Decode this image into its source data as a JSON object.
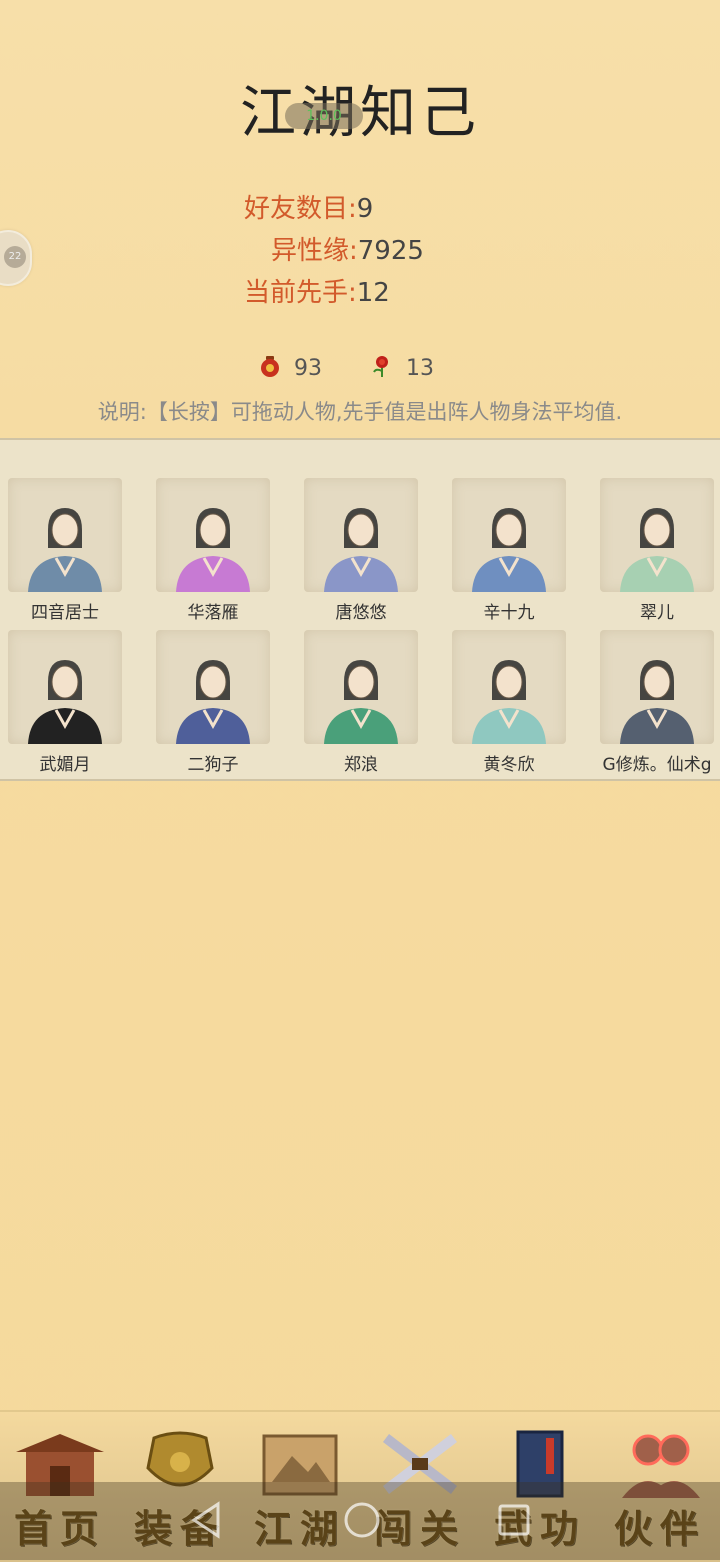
{
  "header": {
    "title": "江湖知己",
    "pill_text": "1.0.0"
  },
  "side_tab": {
    "badge": "22"
  },
  "stats": [
    {
      "label": "好友数目:",
      "value": "9"
    },
    {
      "label": "异性缘:",
      "value": "7925"
    },
    {
      "label": "当前先手:",
      "value": "12"
    }
  ],
  "resources": [
    {
      "icon": "wine-jar-icon",
      "value": "93"
    },
    {
      "icon": "rose-icon",
      "value": "13"
    }
  ],
  "description": "说明:【长按】可拖动人物,先手值是出阵人物身法平均值.",
  "characters": [
    {
      "name": "四音居士",
      "robe": "#6f8ca8"
    },
    {
      "name": "华落雁",
      "robe": "#c77ad3"
    },
    {
      "name": "唐悠悠",
      "robe": "#8a96c8"
    },
    {
      "name": "辛十九",
      "robe": "#6f8fc0"
    },
    {
      "name": "翠儿",
      "robe": "#a7d0b2"
    },
    {
      "name": "武媚月",
      "robe": "#222222"
    },
    {
      "name": "二狗子",
      "robe": "#4f5f9a"
    },
    {
      "name": "郑浪",
      "robe": "#4aa07a"
    },
    {
      "name": "黄冬欣",
      "robe": "#8fc8c0"
    },
    {
      "name": "G修炼。仙术g",
      "robe": "#556070"
    }
  ],
  "nav": [
    {
      "label": "首页",
      "icon": "house-icon"
    },
    {
      "label": "装备",
      "icon": "armor-icon"
    },
    {
      "label": "江湖",
      "icon": "scroll-map-icon"
    },
    {
      "label": "闯关",
      "icon": "crossed-swords-icon"
    },
    {
      "label": "武功",
      "icon": "book-icon"
    },
    {
      "label": "伙伴",
      "icon": "companions-icon"
    }
  ],
  "colors": {
    "accent": "#d25a2b",
    "background": "#f6dca2",
    "nav_text": "#6b4d16"
  }
}
